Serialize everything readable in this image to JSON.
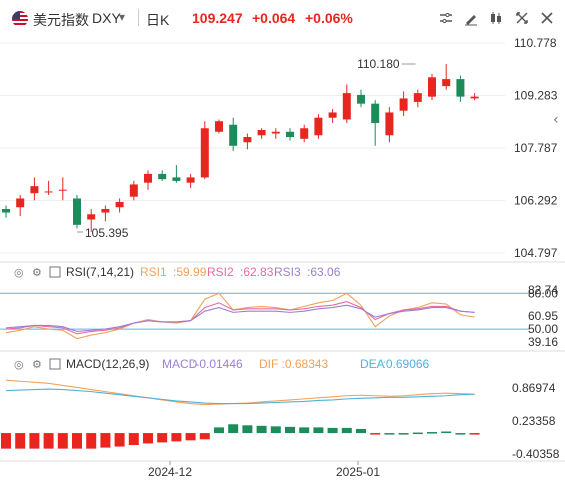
{
  "header": {
    "symbol_name": "美元指数",
    "symbol_code": "DXY",
    "dropdown_glyph": "▾",
    "period": "日K",
    "price": "109.247",
    "change": "+0.064",
    "change_pct": "+0.06%",
    "icons": [
      "indicator-icon",
      "draw-icon",
      "chart-type-icon",
      "fullscreen-icon",
      "close-icon"
    ]
  },
  "colors": {
    "up": "#e8251f",
    "down": "#1e8c5a",
    "rsi1": "#f5a05b",
    "rsi2": "#e86aa0",
    "rsi3": "#9b7fd4",
    "macd_dif": "#f5a05b",
    "macd_dea": "#4fb3d9",
    "level_line": "#5bb0e8",
    "axis_text": "#333333"
  },
  "chart_data": [
    {
      "type": "candlestick",
      "title": "",
      "y_ticks": [
        "110.778",
        "109.283",
        "107.787",
        "106.292",
        "104.797"
      ],
      "ylim": [
        104.797,
        110.778
      ],
      "x_ticks": [
        "2024-12",
        "2025-01"
      ],
      "annotations": [
        {
          "label": "110.180",
          "value": 110.18,
          "index": 28
        },
        {
          "label": "105.395",
          "value": 105.395,
          "index": 5
        }
      ],
      "ohlc": [
        [
          106.05,
          106.15,
          105.8,
          105.95
        ],
        [
          106.1,
          106.45,
          105.85,
          106.35
        ],
        [
          106.5,
          106.95,
          106.3,
          106.7
        ],
        [
          106.55,
          106.85,
          106.45,
          106.55
        ],
        [
          106.6,
          106.95,
          106.3,
          106.6
        ],
        [
          106.35,
          106.45,
          105.5,
          105.6
        ],
        [
          105.75,
          106.05,
          105.4,
          105.9
        ],
        [
          105.95,
          106.15,
          105.7,
          106.05
        ],
        [
          106.1,
          106.35,
          105.95,
          106.25
        ],
        [
          106.4,
          106.85,
          106.3,
          106.75
        ],
        [
          106.8,
          107.15,
          106.6,
          107.05
        ],
        [
          107.05,
          107.15,
          106.85,
          106.9
        ],
        [
          106.95,
          107.3,
          106.8,
          106.85
        ],
        [
          106.8,
          107.05,
          106.65,
          106.95
        ],
        [
          106.95,
          108.55,
          106.9,
          108.35
        ],
        [
          108.25,
          108.6,
          108.2,
          108.55
        ],
        [
          108.45,
          108.65,
          107.7,
          107.85
        ],
        [
          107.95,
          108.2,
          107.75,
          108.1
        ],
        [
          108.15,
          108.35,
          108.05,
          108.3
        ],
        [
          108.2,
          108.35,
          108.05,
          108.25
        ],
        [
          108.25,
          108.35,
          108.0,
          108.1
        ],
        [
          108.05,
          108.45,
          107.95,
          108.35
        ],
        [
          108.15,
          108.75,
          108.05,
          108.65
        ],
        [
          108.65,
          108.9,
          108.5,
          108.8
        ],
        [
          108.6,
          109.6,
          108.5,
          109.35
        ],
        [
          109.3,
          109.45,
          108.95,
          109.05
        ],
        [
          109.05,
          109.15,
          107.85,
          108.5
        ],
        [
          108.15,
          108.95,
          107.95,
          108.8
        ],
        [
          108.85,
          109.4,
          108.7,
          109.2
        ],
        [
          109.1,
          109.45,
          108.95,
          109.35
        ],
        [
          109.25,
          109.9,
          109.15,
          109.8
        ],
        [
          109.55,
          110.18,
          109.45,
          109.75
        ],
        [
          109.75,
          109.85,
          109.1,
          109.25
        ],
        [
          109.2,
          109.35,
          109.15,
          109.25
        ]
      ]
    },
    {
      "type": "line",
      "title": "RSI(7,14,21)",
      "legend": [
        {
          "name": "RSI1",
          "value": "59.99"
        },
        {
          "name": "RSI2",
          "value": "62.83"
        },
        {
          "name": "RSI3",
          "value": "63.06"
        }
      ],
      "y_ticks": [
        "80.00",
        "82.74",
        "60.95",
        "50.00",
        "39.16"
      ],
      "ylim": [
        39.16,
        82.74
      ],
      "levels": [
        80,
        50
      ],
      "series": [
        {
          "name": "RSI1",
          "values": [
            47,
            49,
            52,
            50,
            49,
            42,
            45,
            47,
            50,
            55,
            58,
            56,
            55,
            57,
            75,
            80,
            66,
            68,
            69,
            68,
            66,
            69,
            72,
            74,
            80,
            70,
            52,
            61,
            66,
            68,
            72,
            71,
            62,
            60
          ]
        },
        {
          "name": "RSI2",
          "values": [
            50,
            51,
            53,
            52,
            51,
            46,
            48,
            49,
            51,
            55,
            57,
            56,
            56,
            57,
            68,
            72,
            66,
            67,
            67,
            67,
            66,
            67,
            69,
            70,
            73,
            68,
            58,
            63,
            66,
            67,
            69,
            69,
            65,
            64
          ]
        },
        {
          "name": "RSI3",
          "values": [
            51,
            52,
            53,
            53,
            52,
            48,
            49,
            50,
            52,
            55,
            57,
            56,
            56,
            57,
            65,
            68,
            64,
            65,
            65,
            65,
            64,
            65,
            67,
            68,
            70,
            67,
            60,
            63,
            65,
            66,
            68,
            68,
            65,
            64
          ]
        }
      ]
    },
    {
      "type": "bar",
      "title": "MACD(12,26,9)",
      "legend": [
        {
          "name": "MACD",
          "value": "-0.01446"
        },
        {
          "name": "DIF",
          "value": "0.68343"
        },
        {
          "name": "DEA",
          "value": "0.69066"
        }
      ],
      "y_ticks": [
        "0.86974",
        "0.23358",
        "-0.40358"
      ],
      "ylim": [
        -0.40358,
        0.86974
      ],
      "macd": [
        -0.3,
        -0.3,
        -0.3,
        -0.3,
        -0.3,
        -0.3,
        -0.3,
        -0.28,
        -0.26,
        -0.23,
        -0.2,
        -0.18,
        -0.16,
        -0.14,
        -0.12,
        0.11,
        0.17,
        0.15,
        0.14,
        0.13,
        0.12,
        0.11,
        0.11,
        0.1,
        0.1,
        0.08,
        -0.02,
        0.0,
        0.0,
        0.01,
        0.02,
        0.03,
        0.0,
        -0.01
      ],
      "dif": [
        1.02,
        1.0,
        0.98,
        0.96,
        0.92,
        0.88,
        0.84,
        0.8,
        0.76,
        0.72,
        0.68,
        0.64,
        0.6,
        0.57,
        0.55,
        0.56,
        0.57,
        0.58,
        0.6,
        0.62,
        0.64,
        0.66,
        0.68,
        0.7,
        0.72,
        0.73,
        0.72,
        0.71,
        0.72,
        0.74,
        0.76,
        0.77,
        0.76,
        0.75
      ],
      "dea": [
        0.82,
        0.83,
        0.84,
        0.85,
        0.84,
        0.82,
        0.8,
        0.77,
        0.74,
        0.71,
        0.68,
        0.65,
        0.62,
        0.6,
        0.58,
        0.57,
        0.57,
        0.57,
        0.58,
        0.59,
        0.6,
        0.61,
        0.63,
        0.64,
        0.66,
        0.67,
        0.68,
        0.69,
        0.69,
        0.7,
        0.71,
        0.72,
        0.74,
        0.75
      ]
    }
  ]
}
